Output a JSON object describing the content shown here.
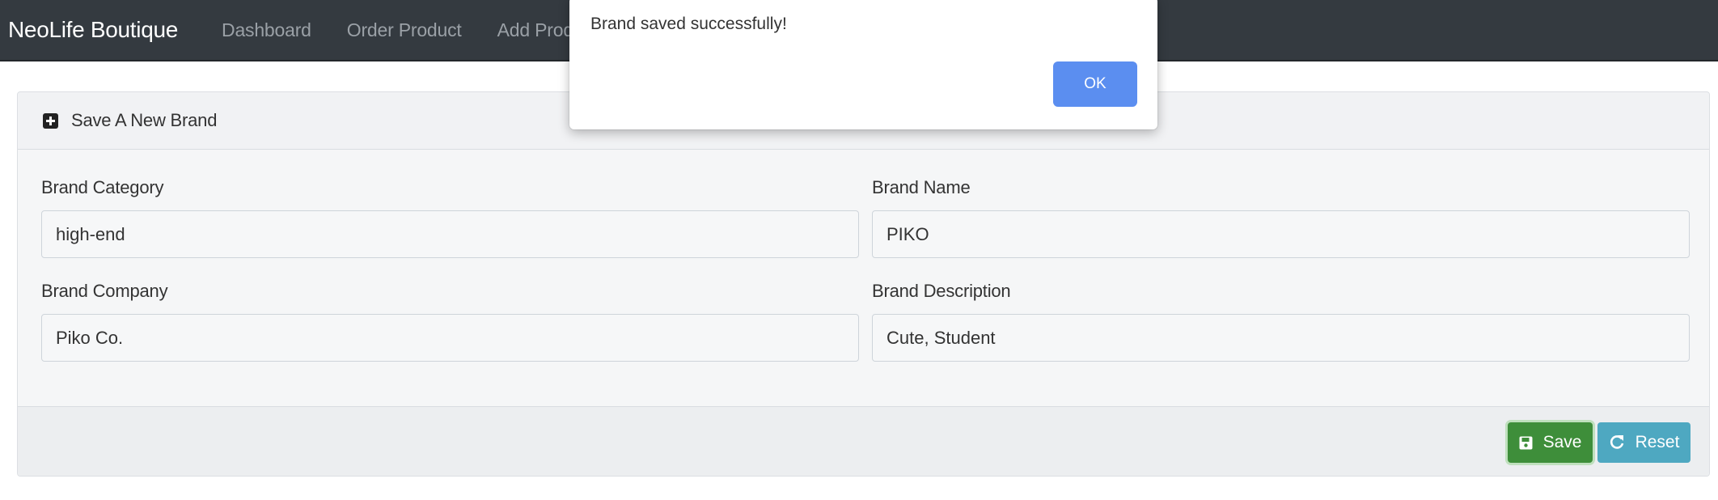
{
  "navbar": {
    "brand": "NeoLife Boutique",
    "links": [
      "Dashboard",
      "Order Product",
      "Add Product"
    ]
  },
  "card": {
    "header_icon": "plus-square-icon",
    "title": "Save A New Brand"
  },
  "form": {
    "brand_category": {
      "label": "Brand Category",
      "value": "high-end"
    },
    "brand_name": {
      "label": "Brand Name",
      "value": "PIKO"
    },
    "brand_company": {
      "label": "Brand Company",
      "value": "Piko Co."
    },
    "brand_description": {
      "label": "Brand Description",
      "value": "Cute, Student"
    }
  },
  "buttons": {
    "save_label": "Save",
    "save_icon": "floppy-disk-icon",
    "reset_label": "Reset",
    "reset_icon": "refresh-icon"
  },
  "alert": {
    "message": "Brand saved successfully!",
    "ok_label": "OK"
  },
  "colors": {
    "navbar": "#343a40",
    "save_button": "#3e8e3a",
    "reset_button": "#4ea8c1",
    "ok_button": "#5b8ef0"
  }
}
